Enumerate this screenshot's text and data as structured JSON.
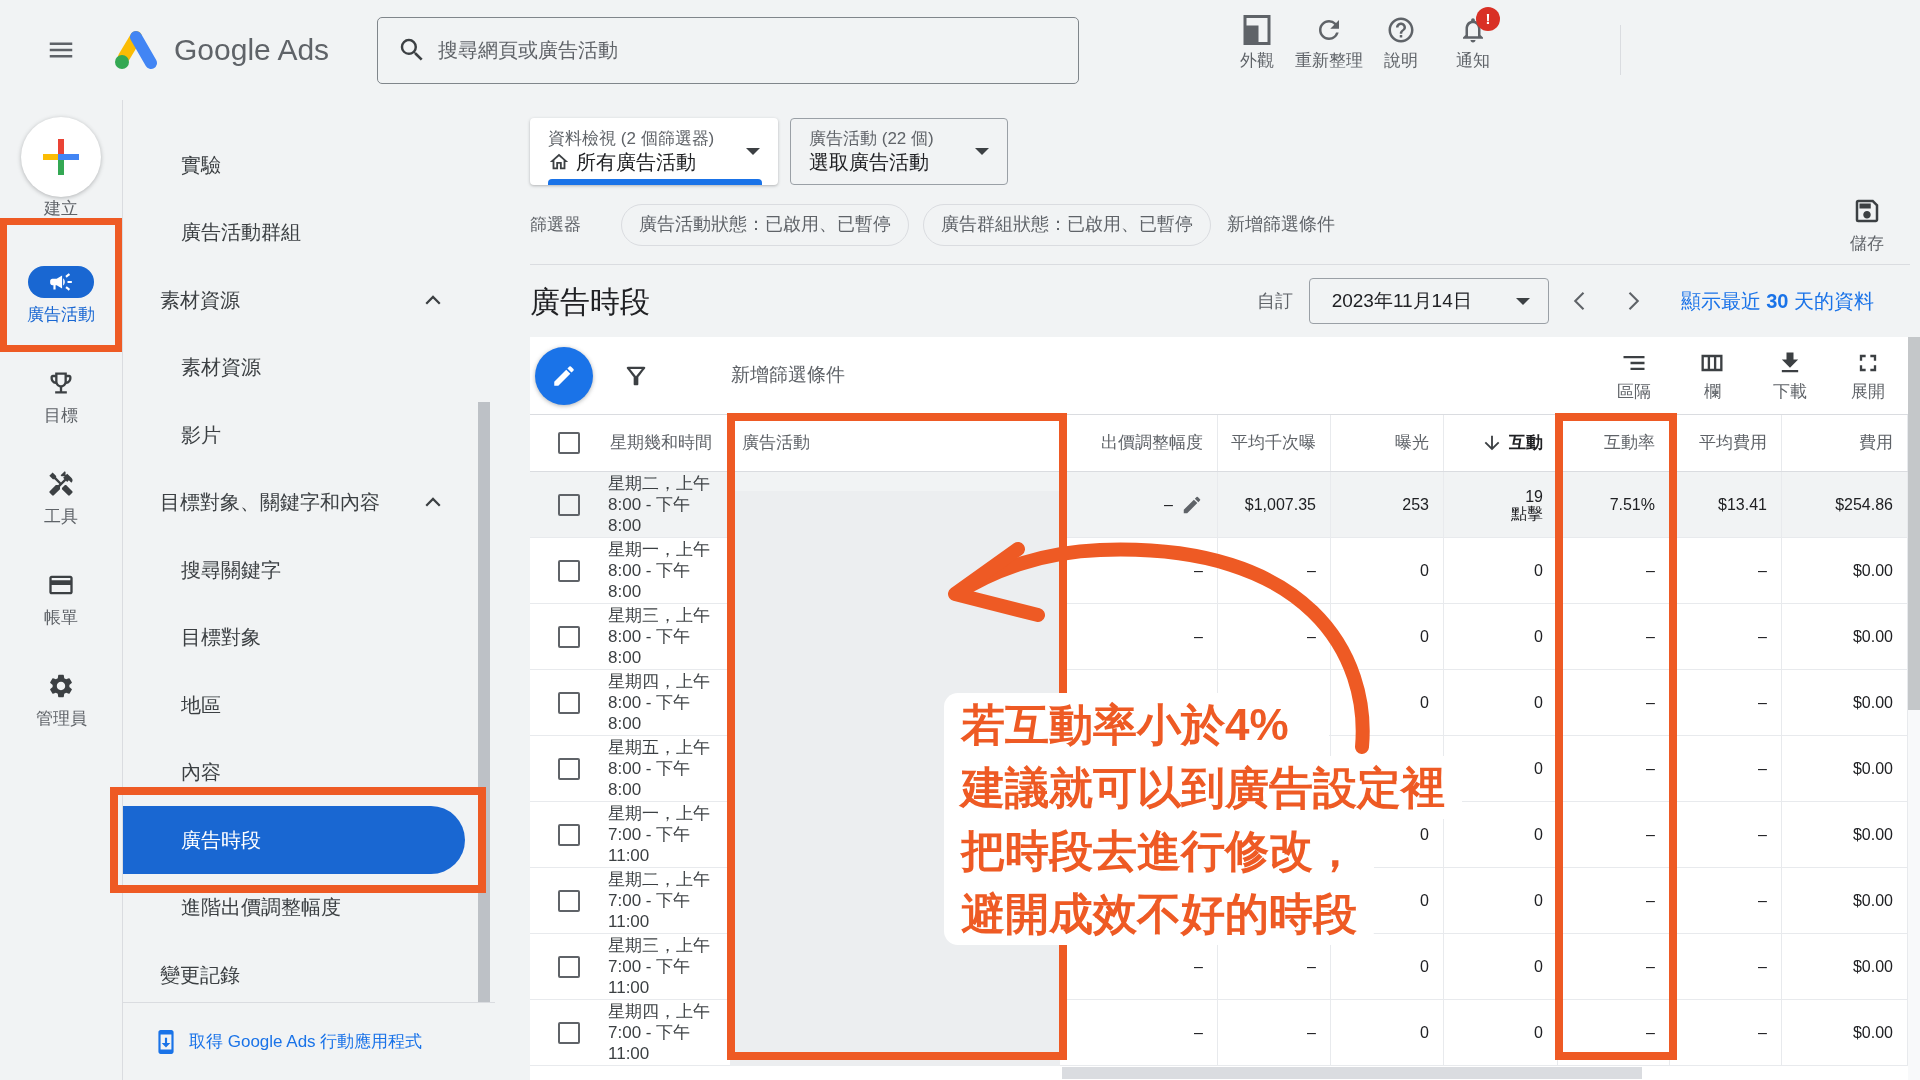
{
  "top_bar": {
    "title": "Google Ads",
    "search": {
      "placeholder": "搜尋網頁或廣告活動"
    },
    "actions": [
      {
        "label": "外觀"
      },
      {
        "label": "重新整理"
      },
      {
        "label": "說明"
      },
      {
        "label": "通知",
        "badge": "!"
      }
    ]
  },
  "rail": {
    "create": {
      "label": "建立"
    },
    "items": [
      {
        "label": "廣告活動",
        "selected": true,
        "highlighted": true
      },
      {
        "label": "目標",
        "selected": false,
        "highlighted": false
      },
      {
        "label": "工具",
        "selected": false,
        "highlighted": false
      },
      {
        "label": "帳單",
        "selected": false,
        "highlighted": false
      },
      {
        "label": "管理員",
        "selected": false,
        "highlighted": false
      }
    ]
  },
  "nav": {
    "items": [
      {
        "children": [
          {
            "label": "實驗",
            "selected": false,
            "highlighted": false
          },
          {
            "label": "廣告活動群組",
            "selected": false,
            "highlighted": false
          }
        ]
      },
      {
        "label": "素材資源",
        "expanded": true,
        "children": [
          {
            "label": "素材資源",
            "selected": false,
            "highlighted": false
          },
          {
            "label": "影片",
            "selected": false,
            "highlighted": false
          }
        ]
      },
      {
        "label": "目標對象、關鍵字和內容",
        "expanded": true,
        "children": [
          {
            "label": "搜尋關鍵字",
            "selected": false,
            "highlighted": false
          },
          {
            "label": "目標對象",
            "selected": false,
            "highlighted": false
          },
          {
            "label": "地區",
            "selected": false,
            "highlighted": false
          },
          {
            "label": "內容",
            "selected": false,
            "highlighted": false
          },
          {
            "label": "廣告時段",
            "selected": true,
            "highlighted": true
          },
          {
            "label": "進階出價調整幅度",
            "selected": false,
            "highlighted": false
          }
        ]
      },
      {
        "label": "變更記錄",
        "selected": false,
        "highlighted": false
      }
    ],
    "footer_link": "取得 Google Ads 行動應用程式"
  },
  "selectors": [
    {
      "label": "資料檢視 (2 個篩選器)",
      "value": "所有廣告活動",
      "selected": true
    },
    {
      "label": "廣告活動 (22 個)",
      "value": "選取廣告活動",
      "selected": false
    }
  ],
  "filters": {
    "label": "篩選器",
    "chips": [
      "廣告活動狀態：已啟用、已暫停",
      "廣告群組狀態：已啟用、已暫停"
    ],
    "add": "新增篩選條件",
    "save": "儲存"
  },
  "page": {
    "title": "廣告時段",
    "date_label": "自訂",
    "date": "2023年11月14日",
    "link": "顯示最近 **30** 天的資料"
  },
  "table_toolbar": {
    "add_filter": "新增篩選條件",
    "tools": [
      "區隔",
      "欄",
      "下載",
      "展開"
    ]
  },
  "table": {
    "header_checked": false,
    "columns": [
      {
        "label": "星期幾和時間",
        "kind": "text",
        "masked": false,
        "highlighted": false,
        "sorted": false
      },
      {
        "label": "廣告活動",
        "kind": "text",
        "masked": true,
        "highlighted": true,
        "sorted": false
      },
      {
        "label": "出價調整幅度",
        "kind": "number",
        "masked": false,
        "highlighted": false,
        "sorted": false
      },
      {
        "label": "平均千次曝",
        "kind": "number",
        "masked": false,
        "highlighted": false,
        "sorted": false
      },
      {
        "label": "曝光",
        "kind": "number",
        "masked": false,
        "highlighted": false,
        "sorted": false
      },
      {
        "label": "互動",
        "kind": "number",
        "masked": false,
        "highlighted": false,
        "sorted": true
      },
      {
        "label": "互動率",
        "kind": "number",
        "masked": false,
        "highlighted": true,
        "sorted": false
      },
      {
        "label": "平均費用",
        "kind": "number",
        "masked": false,
        "highlighted": false,
        "sorted": false
      },
      {
        "label": "費用",
        "kind": "number",
        "masked": false,
        "highlighted": false,
        "sorted": false
      }
    ],
    "rows": [
      {
        "checked": false,
        "hovered": true,
        "cells": [
          "星期二，上午 8:00 - 下午 8:00",
          null,
          "–",
          "$1,007.35",
          "253",
          "19\n點擊",
          "7.51%",
          "$13.41",
          "$254.86"
        ]
      },
      {
        "checked": false,
        "hovered": false,
        "cells": [
          "星期一，上午 8:00 - 下午 8:00",
          null,
          "–",
          "–",
          "0",
          "0",
          "–",
          "–",
          "$0.00"
        ]
      },
      {
        "checked": false,
        "hovered": false,
        "cells": [
          "星期三，上午 8:00 - 下午 8:00",
          null,
          "–",
          "–",
          "0",
          "0",
          "–",
          "–",
          "$0.00"
        ]
      },
      {
        "checked": false,
        "hovered": false,
        "cells": [
          "星期四，上午 8:00 - 下午 8:00",
          null,
          null,
          null,
          "0",
          "0",
          "–",
          "–",
          "$0.00"
        ]
      },
      {
        "checked": false,
        "hovered": false,
        "cells": [
          "星期五，上午 8:00 - 下午 8:00",
          null,
          null,
          null,
          null,
          "0",
          "–",
          "–",
          "$0.00"
        ]
      },
      {
        "checked": false,
        "hovered": false,
        "cells": [
          "星期一，上午 7:00 - 下午 11:00",
          null,
          null,
          null,
          "0",
          "0",
          "–",
          "–",
          "$0.00"
        ]
      },
      {
        "checked": false,
        "hovered": false,
        "cells": [
          "星期二，上午 7:00 - 下午 11:00",
          null,
          null,
          null,
          "0",
          "0",
          "–",
          "–",
          "$0.00"
        ]
      },
      {
        "checked": false,
        "hovered": false,
        "cells": [
          "星期三，上午 7:00 - 下午 11:00",
          null,
          "–",
          "–",
          "0",
          "0",
          "–",
          "–",
          "$0.00"
        ]
      },
      {
        "checked": false,
        "hovered": false,
        "cells": [
          "星期四，上午 7:00 - 下午 11:00",
          null,
          "–",
          "–",
          "0",
          "0",
          "–",
          "–",
          "$0.00"
        ]
      }
    ]
  },
  "callout": {
    "lines": [
      "若互動率小於4%",
      "建議就可以到廣告設定裡",
      "把時段去進行修改，",
      "避開成效不好的時段"
    ]
  }
}
